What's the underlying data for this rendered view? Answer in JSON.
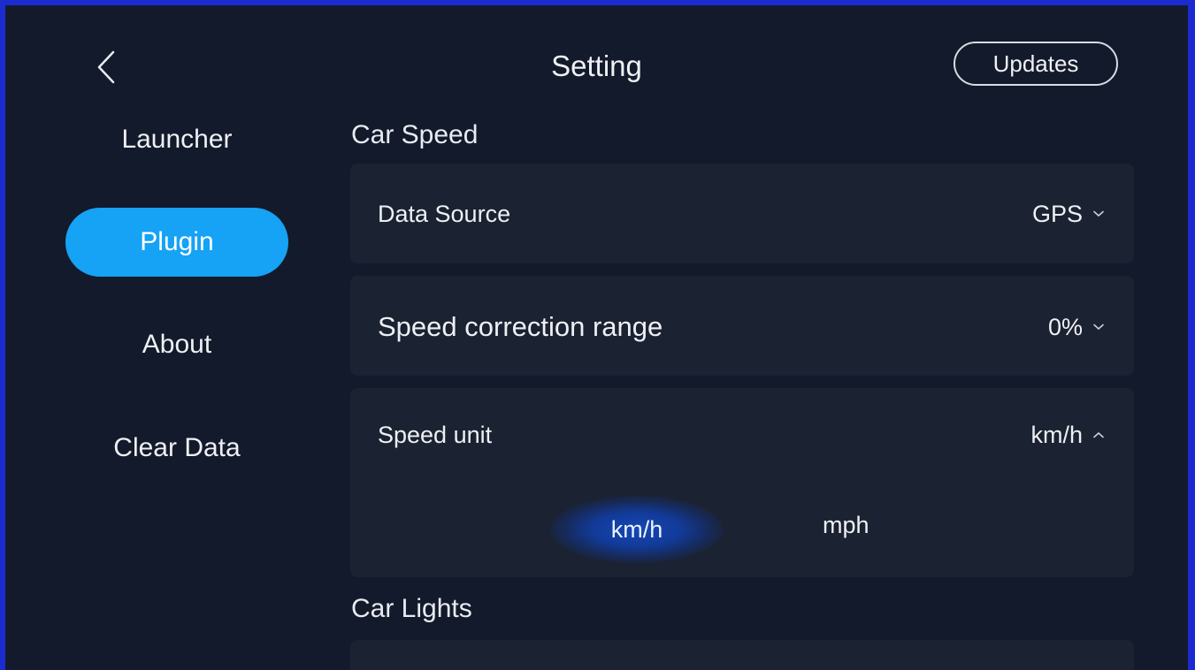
{
  "header": {
    "title": "Setting",
    "updates_label": "Updates"
  },
  "sidebar": {
    "items": [
      {
        "label": "Launcher",
        "active": false
      },
      {
        "label": "Plugin",
        "active": true
      },
      {
        "label": "About",
        "active": false
      },
      {
        "label": "Clear Data",
        "active": false
      }
    ]
  },
  "car_speed": {
    "section_title": "Car Speed",
    "data_source": {
      "label": "Data Source",
      "value": "GPS",
      "icon": "chevron-down-icon"
    },
    "correction": {
      "label": "Speed correction range",
      "value": "0%",
      "icon": "chevron-down-icon"
    },
    "speed_unit": {
      "label": "Speed unit",
      "value": "km/h",
      "icon": "chevron-up-icon",
      "options": [
        {
          "label": "km/h",
          "selected": true
        },
        {
          "label": "mph",
          "selected": false
        }
      ]
    }
  },
  "car_lights": {
    "section_title": "Car Lights"
  },
  "colors": {
    "background": "#131a2b",
    "card": "#1b2231",
    "accent": "#16a2f5",
    "selected_glow": "#1547b5",
    "frame": "#1c2bd0"
  }
}
